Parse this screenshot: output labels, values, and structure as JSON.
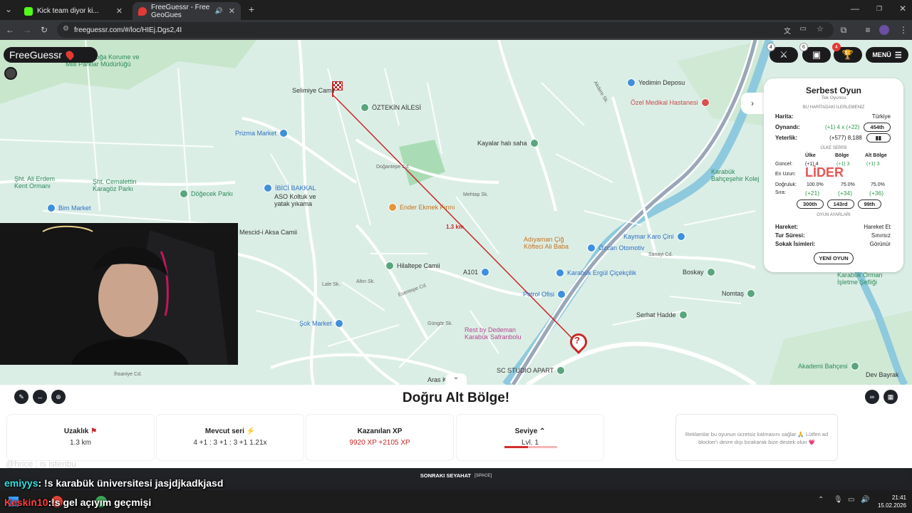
{
  "browser": {
    "tabs": [
      {
        "title": "Kick team diyor ki...",
        "active": false
      },
      {
        "title": "FreeGuessr - Free GeoGues",
        "active": true
      }
    ],
    "url": "freeguessr.com/#/loc/HIEj.Dgs2,4I",
    "new_tab": "+"
  },
  "game": {
    "logo": "FreeGuessr",
    "menu_label": "MENÜ",
    "badges": {
      "versus": "4",
      "garage": "6",
      "trophy": "4"
    },
    "distance_label": "1.3 km"
  },
  "map": {
    "pois": [
      "Karabük Doğa Korume ve Milli Parklar Müdürlüğü",
      "Selimiye Camii",
      "ÖZTEKİN AİLESİ",
      "Yedimin Deposu",
      "Özel Medikal Hastanesi",
      "Prizma Market",
      "Kayalar halı saha",
      "Karabük Bahçeşehir Kolej",
      "Şht. Cemalettin Karagöz Parkı",
      "Şht. Ali Erdem Kent Ormanı",
      "Döğecek Parkı",
      "Bim Market",
      "İBİCİ BAKKAL",
      "ASO Koltuk ve yatak yıkama",
      "Ender Ekmek Fırını",
      "Mescid-i Aksa Camii",
      "Adıyaman Çiğ Köfteci Ali Baba",
      "Özcan Otomotiv",
      "Kaymar Karo Çini",
      "Hilaltepe Camii",
      "A101",
      "Karabük Ergül Çiçekçilik",
      "Petrol Ofisi",
      "Boskay",
      "Nomtaş",
      "Karabük Orman İşletme Şefliği",
      "Serhat Hadde",
      "Şok Market",
      "Rest by Dedeman Karabük Safranbolu",
      "Akademi Bahçesi",
      "SC STUDIO APART",
      "Dev Bayrak",
      "Aras Kargo",
      "ven Eczanesi"
    ],
    "streets": [
      "Mehtap Sk.",
      "Doğantepe Cd.",
      "Güngör Sk.",
      "Esentepe Cd.",
      "Altın Sk.",
      "Lale Sk.",
      "Sanayi Cd.",
      "Akdere Sk.",
      "İhsaniye Cd."
    ]
  },
  "panel": {
    "title": "Serbest Oyun",
    "subtitle": "Tek Oyuncu",
    "section_progress": "BU HARİTADAKİ İLERLEMENİZ",
    "map_label": "Harita:",
    "map_value": "Türkiye",
    "played_label": "Oynandı:",
    "played_value": "(+1) 4 x (+22)",
    "played_rank": "454th",
    "ability_label": "Yeterlik:",
    "ability_value": "(+577) 8,188",
    "section_country": "ÜLKE SERİSİ",
    "col_country": "Ülke",
    "col_region": "Bölge",
    "col_subregion": "Alt Bölge",
    "current_label": "Güncel:",
    "current_values": [
      "(+1) 4",
      "(+1) 3",
      "(+1) 3"
    ],
    "longest_label": "En Uzun:",
    "accuracy_label": "Doğruluk:",
    "accuracy_values": [
      "100.0%",
      "75.0%",
      "75.0%"
    ],
    "rank_label": "Sıra:",
    "rank_delta": [
      "(+21)",
      "(+34)",
      "(+36)"
    ],
    "rank_values": [
      "300th",
      "143rd",
      "99th"
    ],
    "section_settings": "OYUN AYARLARI",
    "move_label": "Hareket:",
    "move_value": "Hareket Et",
    "time_label": "Tur Süresi:",
    "time_value": "Sınırsız",
    "street_label": "Sokak İsimleri:",
    "street_value": "Görünür",
    "new_game": "YENİ OYUN"
  },
  "result": {
    "headline": "Doğru Alt Bölge!",
    "distance_title": "Uzaklık",
    "distance_value": "1.3 km",
    "streak_title": "Mevcut seri",
    "streak_value": "4 +1 : 3 +1 : 3 +1  1.21x",
    "xp_title": "Kazanılan XP",
    "xp_value": "9920 XP  +2105 XP",
    "level_title": "Seviye",
    "level_value": "Lvl. 1",
    "level_progress": 0.45,
    "ad_text": "Reklamlar bu oyunun ücretsiz kalmasını sağlar 🙏 Lütfen ad blocker'ı devre dışı bırakarak bize destek olun 💗",
    "next_label": "SONRAKI SEYAHAT",
    "next_hint": "[SPACE]"
  },
  "stream": {
    "chat1_user": "emiyys",
    "chat1_msg": ": !s karabük üniversitesi jasjdjkadkjasd",
    "chat2_user": "Keskin10",
    "chat2_msg": ":!s gel açıyım geçmişi",
    "faded_chat": "@hrice : is istenbu",
    "watermark": "LİDER"
  },
  "taskbar": {
    "time": "21:41",
    "date": "15.02.2026"
  },
  "colors": {
    "map_bg": "#dbeee6",
    "route_line": "#c62828",
    "accent_green": "#2e9a4a",
    "level_bar": "#d32f2f"
  }
}
